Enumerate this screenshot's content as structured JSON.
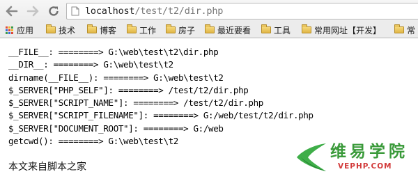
{
  "browser": {
    "url_host": "localhost",
    "url_path": "/test/t2/dir.php"
  },
  "bookmarks": [
    {
      "label": "应用",
      "icon": "apps-grid-icon"
    },
    {
      "label": "技术",
      "icon": "folder-icon"
    },
    {
      "label": "博客",
      "icon": "folder-icon"
    },
    {
      "label": "工作",
      "icon": "folder-icon"
    },
    {
      "label": "房子",
      "icon": "folder-icon"
    },
    {
      "label": "最近要看",
      "icon": "folder-icon"
    },
    {
      "label": "工具",
      "icon": "folder-icon"
    },
    {
      "label": "常用网址【开发】",
      "icon": "folder-icon"
    },
    {
      "label": "常",
      "icon": "folder-icon"
    }
  ],
  "output_lines": [
    "__FILE__: ========> G:\\web\\test\\t2\\dir.php",
    "__DIR__: ========> G:\\web\\test\\t2",
    "dirname(__FILE__): ========> G:\\web\\test\\t2",
    "$_SERVER[\"PHP_SELF\"]: ========> /test/t2/dir.php",
    "$_SERVER[\"SCRIPT_NAME\"]: ========> /test/t2/dir.php",
    "$_SERVER[\"SCRIPT_FILENAME\"]: ========> G:/web/test/t2/dir.php",
    "$_SERVER[\"DOCUMENT_ROOT\"]: ========> G:/web",
    "getcwd(): ========> G:\\web\\test\\t2"
  ],
  "footer_text": "本文来自脚本之家",
  "watermark": {
    "name_cn": "维易学院",
    "name_en": "VEPHP.COM",
    "colors": {
      "green": "#3a9a3a",
      "red": "#d23a3a"
    }
  }
}
